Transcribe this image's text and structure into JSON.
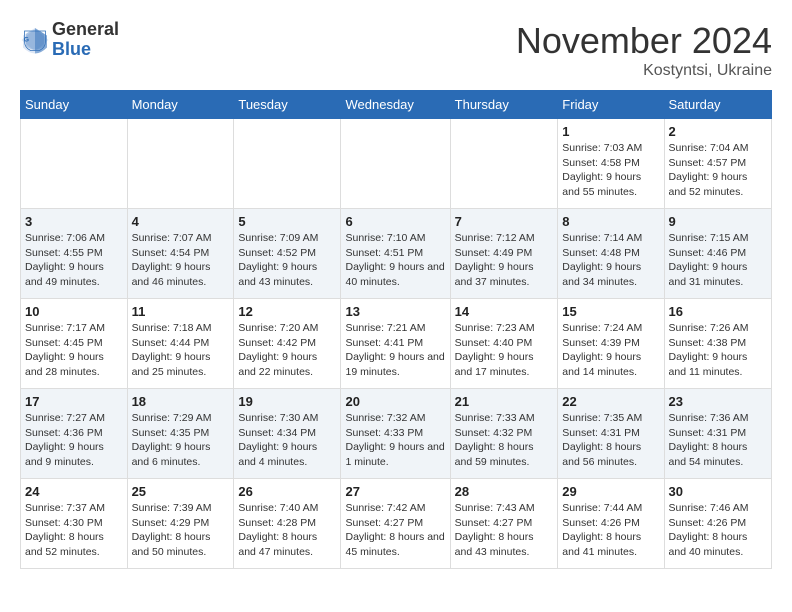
{
  "logo": {
    "general": "General",
    "blue": "Blue"
  },
  "title": "November 2024",
  "location": "Kostyntsi, Ukraine",
  "weekdays": [
    "Sunday",
    "Monday",
    "Tuesday",
    "Wednesday",
    "Thursday",
    "Friday",
    "Saturday"
  ],
  "weeks": [
    [
      {
        "day": "",
        "info": ""
      },
      {
        "day": "",
        "info": ""
      },
      {
        "day": "",
        "info": ""
      },
      {
        "day": "",
        "info": ""
      },
      {
        "day": "",
        "info": ""
      },
      {
        "day": "1",
        "info": "Sunrise: 7:03 AM\nSunset: 4:58 PM\nDaylight: 9 hours\nand 55 minutes."
      },
      {
        "day": "2",
        "info": "Sunrise: 7:04 AM\nSunset: 4:57 PM\nDaylight: 9 hours\nand 52 minutes."
      }
    ],
    [
      {
        "day": "3",
        "info": "Sunrise: 7:06 AM\nSunset: 4:55 PM\nDaylight: 9 hours\nand 49 minutes."
      },
      {
        "day": "4",
        "info": "Sunrise: 7:07 AM\nSunset: 4:54 PM\nDaylight: 9 hours\nand 46 minutes."
      },
      {
        "day": "5",
        "info": "Sunrise: 7:09 AM\nSunset: 4:52 PM\nDaylight: 9 hours\nand 43 minutes."
      },
      {
        "day": "6",
        "info": "Sunrise: 7:10 AM\nSunset: 4:51 PM\nDaylight: 9 hours\nand 40 minutes."
      },
      {
        "day": "7",
        "info": "Sunrise: 7:12 AM\nSunset: 4:49 PM\nDaylight: 9 hours\nand 37 minutes."
      },
      {
        "day": "8",
        "info": "Sunrise: 7:14 AM\nSunset: 4:48 PM\nDaylight: 9 hours\nand 34 minutes."
      },
      {
        "day": "9",
        "info": "Sunrise: 7:15 AM\nSunset: 4:46 PM\nDaylight: 9 hours\nand 31 minutes."
      }
    ],
    [
      {
        "day": "10",
        "info": "Sunrise: 7:17 AM\nSunset: 4:45 PM\nDaylight: 9 hours\nand 28 minutes."
      },
      {
        "day": "11",
        "info": "Sunrise: 7:18 AM\nSunset: 4:44 PM\nDaylight: 9 hours\nand 25 minutes."
      },
      {
        "day": "12",
        "info": "Sunrise: 7:20 AM\nSunset: 4:42 PM\nDaylight: 9 hours\nand 22 minutes."
      },
      {
        "day": "13",
        "info": "Sunrise: 7:21 AM\nSunset: 4:41 PM\nDaylight: 9 hours\nand 19 minutes."
      },
      {
        "day": "14",
        "info": "Sunrise: 7:23 AM\nSunset: 4:40 PM\nDaylight: 9 hours\nand 17 minutes."
      },
      {
        "day": "15",
        "info": "Sunrise: 7:24 AM\nSunset: 4:39 PM\nDaylight: 9 hours\nand 14 minutes."
      },
      {
        "day": "16",
        "info": "Sunrise: 7:26 AM\nSunset: 4:38 PM\nDaylight: 9 hours\nand 11 minutes."
      }
    ],
    [
      {
        "day": "17",
        "info": "Sunrise: 7:27 AM\nSunset: 4:36 PM\nDaylight: 9 hours\nand 9 minutes."
      },
      {
        "day": "18",
        "info": "Sunrise: 7:29 AM\nSunset: 4:35 PM\nDaylight: 9 hours\nand 6 minutes."
      },
      {
        "day": "19",
        "info": "Sunrise: 7:30 AM\nSunset: 4:34 PM\nDaylight: 9 hours\nand 4 minutes."
      },
      {
        "day": "20",
        "info": "Sunrise: 7:32 AM\nSunset: 4:33 PM\nDaylight: 9 hours\nand 1 minute."
      },
      {
        "day": "21",
        "info": "Sunrise: 7:33 AM\nSunset: 4:32 PM\nDaylight: 8 hours\nand 59 minutes."
      },
      {
        "day": "22",
        "info": "Sunrise: 7:35 AM\nSunset: 4:31 PM\nDaylight: 8 hours\nand 56 minutes."
      },
      {
        "day": "23",
        "info": "Sunrise: 7:36 AM\nSunset: 4:31 PM\nDaylight: 8 hours\nand 54 minutes."
      }
    ],
    [
      {
        "day": "24",
        "info": "Sunrise: 7:37 AM\nSunset: 4:30 PM\nDaylight: 8 hours\nand 52 minutes."
      },
      {
        "day": "25",
        "info": "Sunrise: 7:39 AM\nSunset: 4:29 PM\nDaylight: 8 hours\nand 50 minutes."
      },
      {
        "day": "26",
        "info": "Sunrise: 7:40 AM\nSunset: 4:28 PM\nDaylight: 8 hours\nand 47 minutes."
      },
      {
        "day": "27",
        "info": "Sunrise: 7:42 AM\nSunset: 4:27 PM\nDaylight: 8 hours\nand 45 minutes."
      },
      {
        "day": "28",
        "info": "Sunrise: 7:43 AM\nSunset: 4:27 PM\nDaylight: 8 hours\nand 43 minutes."
      },
      {
        "day": "29",
        "info": "Sunrise: 7:44 AM\nSunset: 4:26 PM\nDaylight: 8 hours\nand 41 minutes."
      },
      {
        "day": "30",
        "info": "Sunrise: 7:46 AM\nSunset: 4:26 PM\nDaylight: 8 hours\nand 40 minutes."
      }
    ]
  ]
}
